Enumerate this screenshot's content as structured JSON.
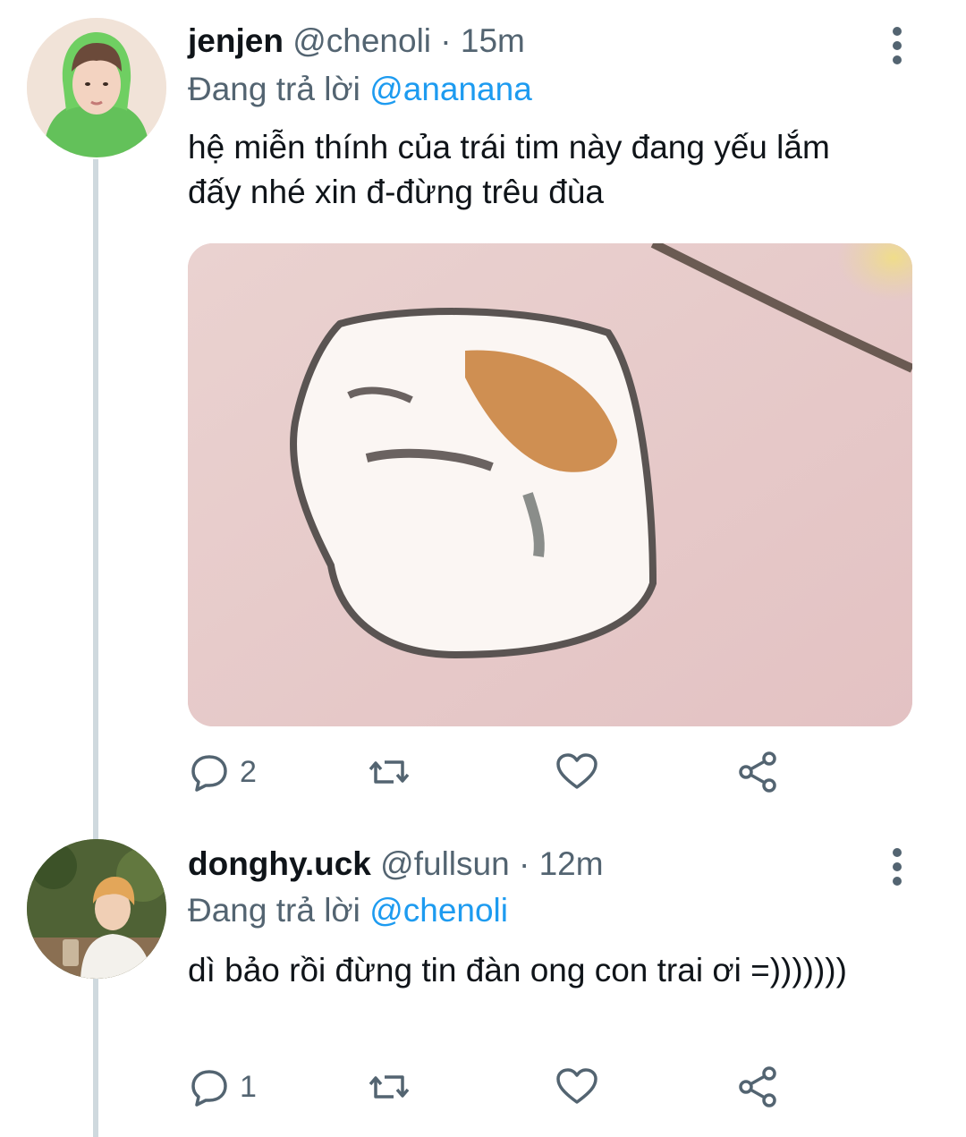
{
  "tweets": [
    {
      "display_name": "jenjen",
      "handle": "@chenoli",
      "separator": "·",
      "time": "15m",
      "reply_prefix": "Đang trả lời",
      "reply_to": "@ananana",
      "text": "hệ miễn thính của trái tim này đang yếu lắm đấy nhé xin đ-đừng trêu đùa",
      "reply_count": "2",
      "has_media": true
    },
    {
      "display_name": "donghy.uck",
      "handle": "@fullsun",
      "separator": "·",
      "time": "12m",
      "reply_prefix": "Đang trả lời",
      "reply_to": "@chenoli",
      "text": "dì bảo rồi đừng tin đàn ong con trai ơi =)))))))",
      "reply_count": "1",
      "has_media": false
    }
  ],
  "icons": {
    "reply": "speech-bubble-icon",
    "retweet": "retweet-icon",
    "like": "heart-icon",
    "share": "share-icon",
    "more": "more-vertical-icon"
  },
  "colors": {
    "text": "#0f1419",
    "secondary": "#536471",
    "link": "#1d9bf0",
    "thread_line": "#cfd9de"
  }
}
